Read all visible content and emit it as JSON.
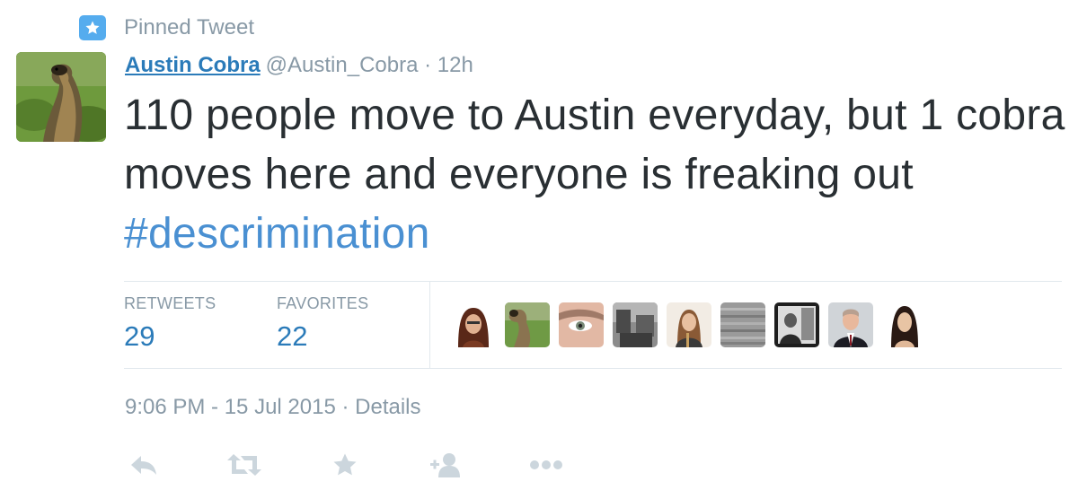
{
  "pinned_label": "Pinned Tweet",
  "author": {
    "name": "Austin Cobra",
    "handle": "@Austin_Cobra",
    "separator": "·",
    "time": "12h"
  },
  "tweet": {
    "text_before": "110 people move to Austin everyday, but 1 cobra moves here and everyone is freaking out ",
    "hashtag": "#descrimination"
  },
  "stats": {
    "retweets_label": "RETWEETS",
    "retweets_value": "29",
    "favorites_label": "FAVORITES",
    "favorites_value": "22"
  },
  "favoriters_count_shown": 9,
  "meta": {
    "timestamp": "9:06 PM - 15 Jul 2015",
    "separator": "·",
    "details_label": "Details"
  },
  "actions": [
    "reply-icon",
    "retweet-icon",
    "favorite-star-icon",
    "follow-icon",
    "more-icon"
  ],
  "colors": {
    "link_blue": "#2b7bb9",
    "hashtag_blue": "#4a90d2",
    "muted_gray": "#8899a6",
    "icon_gray": "#ccd6dd",
    "pin_badge": "#55acee"
  }
}
